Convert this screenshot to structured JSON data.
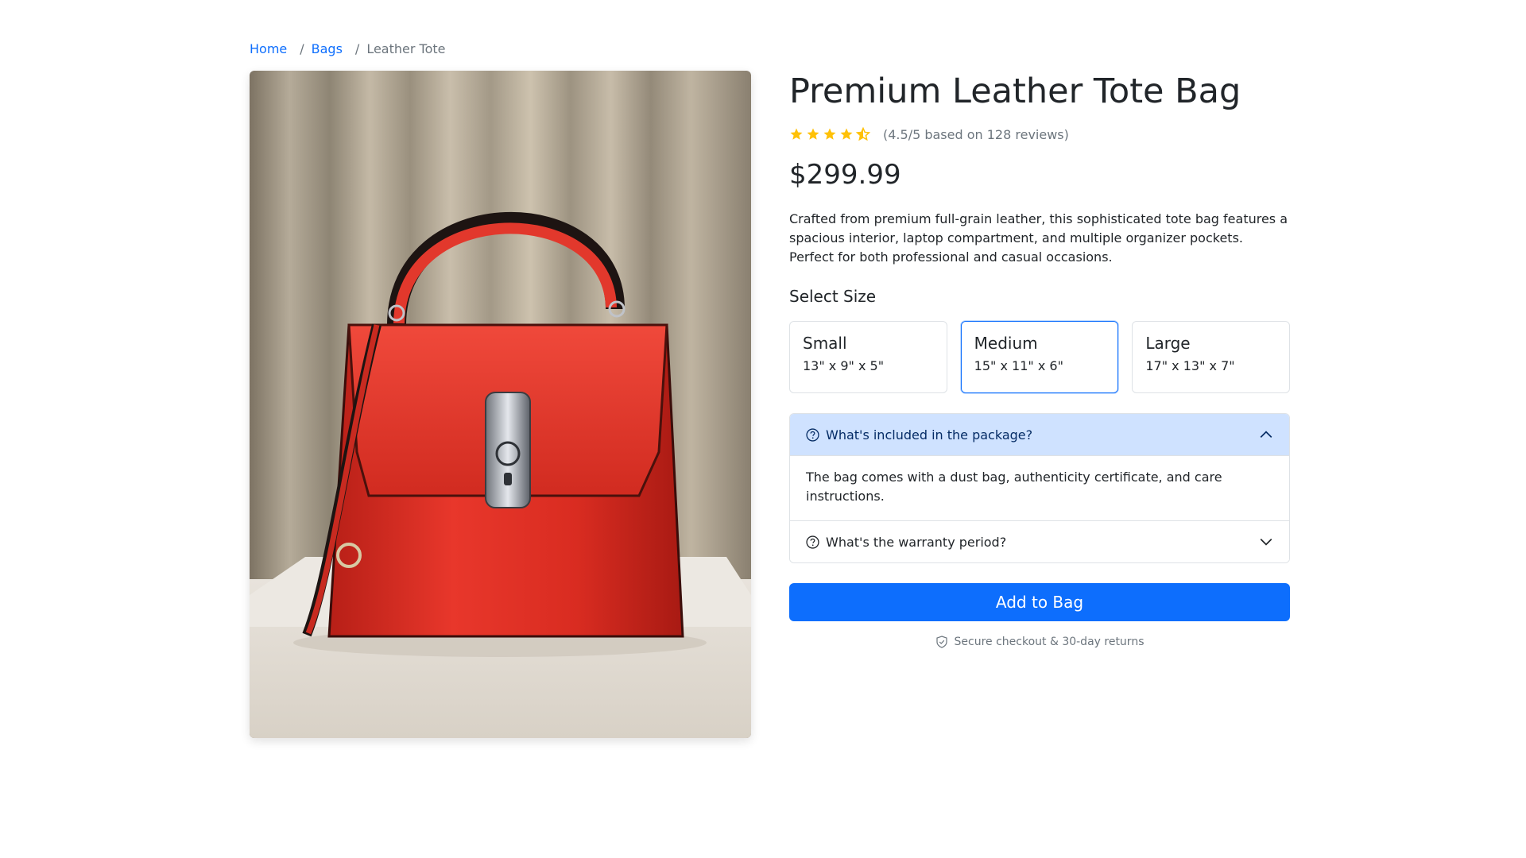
{
  "breadcrumb": {
    "items": [
      {
        "label": "Home"
      },
      {
        "label": "Bags"
      }
    ],
    "separator": "/",
    "current": "Leather Tote"
  },
  "product": {
    "title": "Premium Leather Tote Bag",
    "rating": {
      "value": 4.5,
      "max": 5,
      "text": "(4.5/5 based on 128 reviews)"
    },
    "price": "$299.99",
    "description": "Crafted from premium full-grain leather, this sophisticated tote bag features a spacious interior, laptop compartment, and multiple organizer pockets. Perfect for both professional and casual occasions.",
    "image_icon": "red-leather-handbag-photo"
  },
  "size_selector": {
    "label": "Select Size",
    "selected": "Medium",
    "options": [
      {
        "name": "Small",
        "dims": "13\" x 9\" x 5\""
      },
      {
        "name": "Medium",
        "dims": "15\" x 11\" x 6\""
      },
      {
        "name": "Large",
        "dims": "17\" x 13\" x 7\""
      }
    ]
  },
  "faq": [
    {
      "question": "What's included in the package?",
      "answer": "The bag comes with a dust bag, authenticity certificate, and care instructions.",
      "open": true
    },
    {
      "question": "What's the warranty period?",
      "open": false
    }
  ],
  "cta": {
    "add_label": "Add to Bag",
    "secure_text": "Secure checkout & 30-day returns"
  },
  "colors": {
    "accent": "#0d6efd",
    "star": "#ffc107",
    "accordion_open_bg": "#cfe2ff",
    "muted": "#6c757d"
  }
}
